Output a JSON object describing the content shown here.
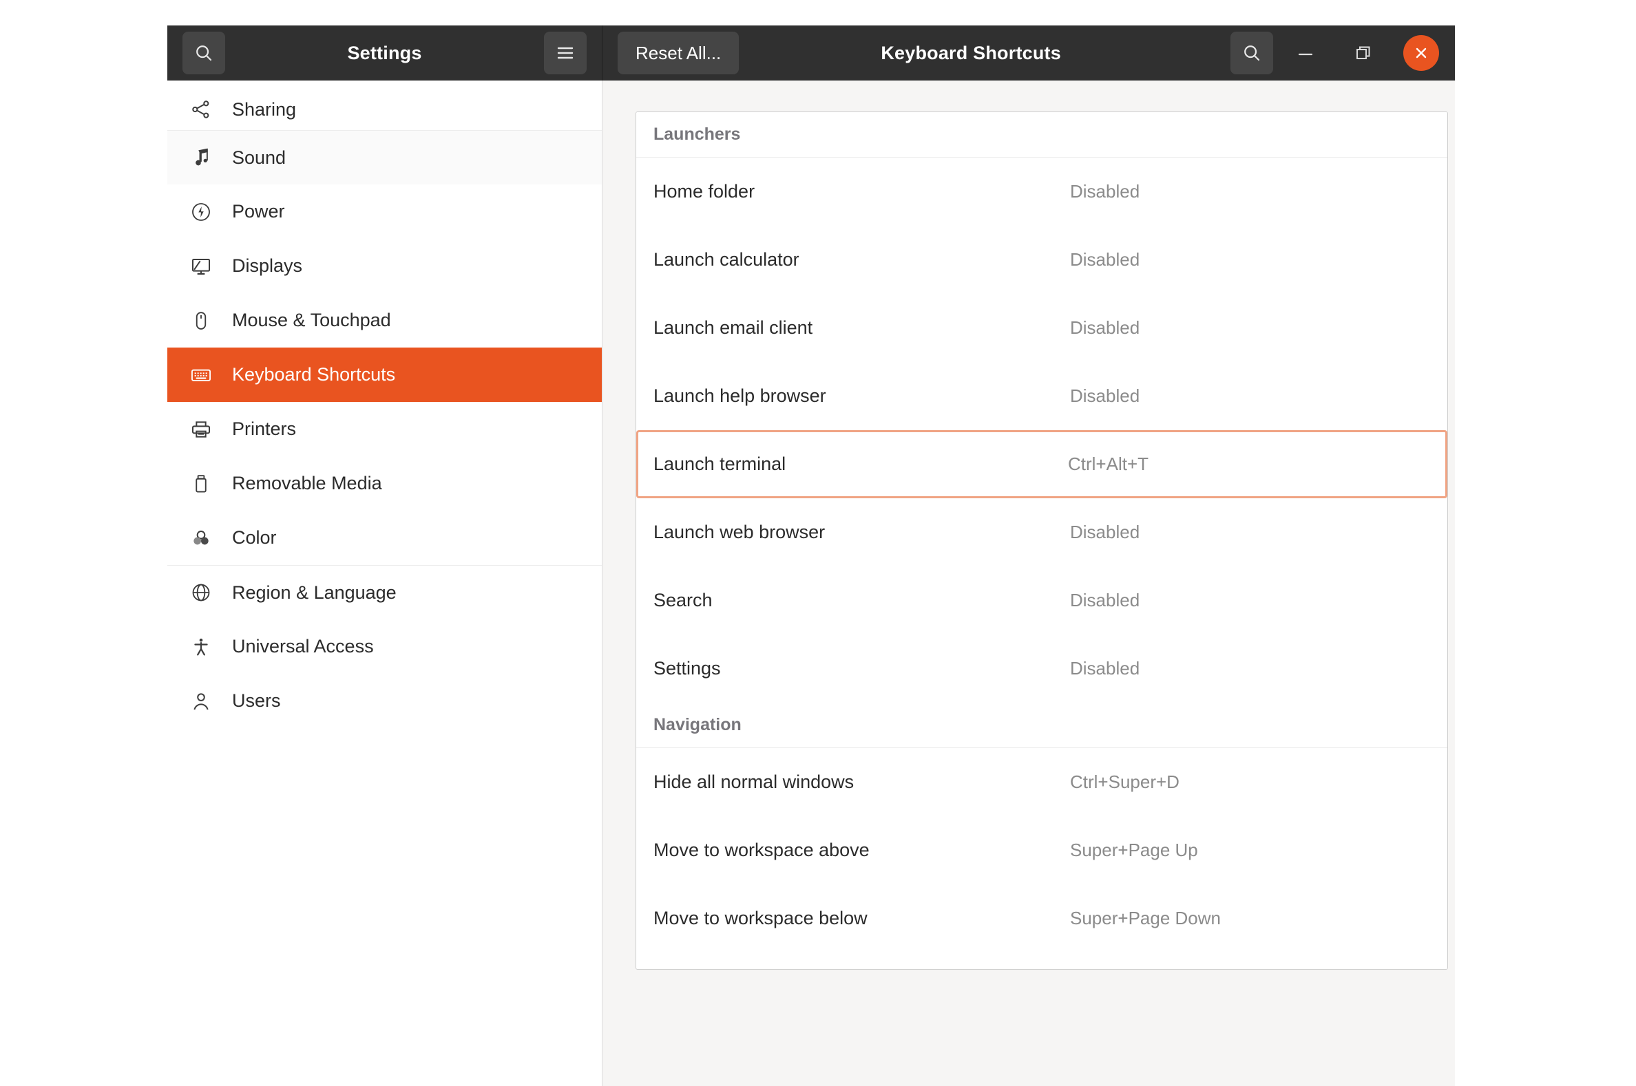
{
  "window": {
    "sidebar_header": {
      "search_icon": "search-icon",
      "title": "Settings",
      "menu_icon": "hamburger-menu-icon"
    },
    "panel_header": {
      "reset_all_label": "Reset All...",
      "title": "Keyboard Shortcuts",
      "search_icon": "search-icon",
      "minimize_icon": "minimize-icon",
      "maximize_icon": "maximize-restore-icon",
      "close_icon": "close-icon"
    }
  },
  "theme": {
    "accent": "#E95420",
    "headerbar_bg": "#303030",
    "content_bg": "#f6f5f4",
    "focus_border": "#f0a484",
    "muted_text": "#8b8b8b"
  },
  "sidebar": {
    "items": [
      {
        "label": "Sharing",
        "icon": "share-icon",
        "state": "clipped"
      },
      {
        "label": "Sound",
        "icon": "music-note-icon",
        "state": "alt"
      },
      {
        "label": "Power",
        "icon": "power-icon",
        "state": "normal"
      },
      {
        "label": "Displays",
        "icon": "display-icon",
        "state": "normal"
      },
      {
        "label": "Mouse & Touchpad",
        "icon": "mouse-icon",
        "state": "normal"
      },
      {
        "label": "Keyboard Shortcuts",
        "icon": "keyboard-icon",
        "state": "selected"
      },
      {
        "label": "Printers",
        "icon": "printer-icon",
        "state": "normal"
      },
      {
        "label": "Removable Media",
        "icon": "usb-drive-icon",
        "state": "normal"
      },
      {
        "label": "Color",
        "icon": "color-circles-icon",
        "state": "normal"
      },
      {
        "label": "Region & Language",
        "icon": "globe-icon",
        "state": "normal"
      },
      {
        "label": "Universal Access",
        "icon": "accessibility-icon",
        "state": "normal"
      },
      {
        "label": "Users",
        "icon": "person-icon",
        "state": "normal"
      }
    ]
  },
  "shortcuts": {
    "groups": [
      {
        "title": "Launchers",
        "rows": [
          {
            "name": "Home folder",
            "value": "Disabled",
            "focused": false
          },
          {
            "name": "Launch calculator",
            "value": "Disabled",
            "focused": false
          },
          {
            "name": "Launch email client",
            "value": "Disabled",
            "focused": false
          },
          {
            "name": "Launch help browser",
            "value": "Disabled",
            "focused": false
          },
          {
            "name": "Launch terminal",
            "value": "Ctrl+Alt+T",
            "focused": true
          },
          {
            "name": "Launch web browser",
            "value": "Disabled",
            "focused": false
          },
          {
            "name": "Search",
            "value": "Disabled",
            "focused": false
          },
          {
            "name": "Settings",
            "value": "Disabled",
            "focused": false
          }
        ]
      },
      {
        "title": "Navigation",
        "rows": [
          {
            "name": "Hide all normal windows",
            "value": "Ctrl+Super+D",
            "focused": false
          },
          {
            "name": "Move to workspace above",
            "value": "Super+Page Up",
            "focused": false
          },
          {
            "name": "Move to workspace below",
            "value": "Super+Page Down",
            "focused": false
          }
        ]
      }
    ]
  }
}
